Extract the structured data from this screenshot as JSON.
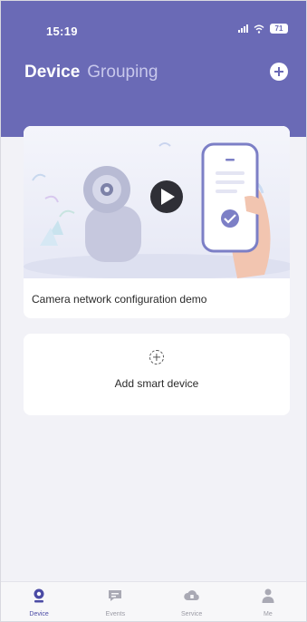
{
  "status_bar": {
    "time": "15:19",
    "battery": "71"
  },
  "header": {
    "tabs": [
      {
        "label": "Device"
      },
      {
        "label": "Grouping"
      }
    ],
    "add_icon": "plus-circle-icon"
  },
  "demo_card": {
    "caption": "Camera network configuration demo",
    "icons": [
      "camera-icon",
      "play-icon",
      "phone-icon",
      "checkmark-icon"
    ]
  },
  "add_device_card": {
    "label": "Add smart device",
    "icon": "dashed-plus-icon"
  },
  "bottom_nav": {
    "items": [
      {
        "label": "Device",
        "icon": "camera-icon"
      },
      {
        "label": "Events",
        "icon": "message-icon"
      },
      {
        "label": "Service",
        "icon": "cloud-icon"
      },
      {
        "label": "Me",
        "icon": "person-icon"
      }
    ]
  },
  "colors": {
    "accent": "#6a6ab6",
    "active_nav": "#4b4ba5",
    "inactive_tab": "#c8c8ec",
    "background": "#f2f2f7"
  }
}
